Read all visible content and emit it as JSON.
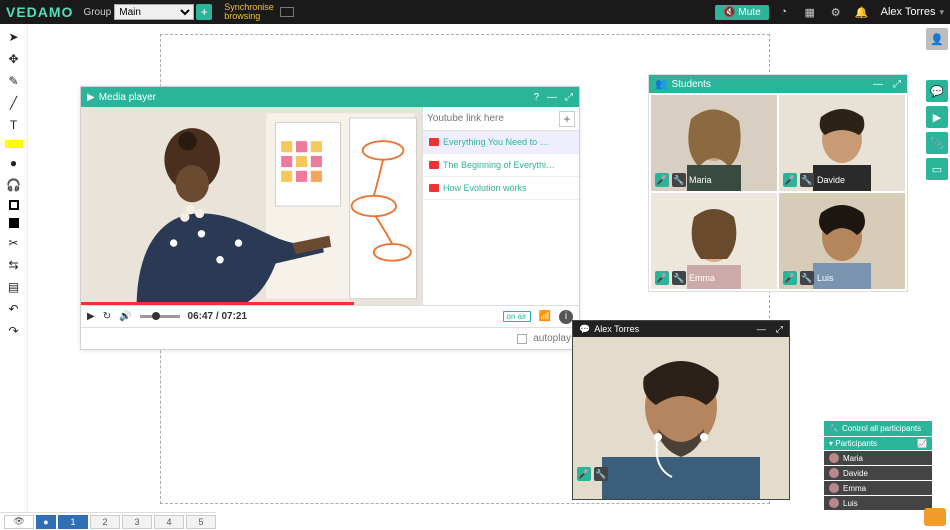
{
  "brand": "VEDAMO",
  "group": {
    "label": "Group",
    "value": "Main"
  },
  "sync_label": "Synchronise\nbrowsing",
  "mute_label": "Mute",
  "user_name": "Alex Torres",
  "media_player": {
    "title": "Media player",
    "search_placeholder": "Youtube link here",
    "playlist": [
      {
        "title": "Everything You Need to …",
        "selected": true
      },
      {
        "title": "The Beginning of Everythi…",
        "selected": false
      },
      {
        "title": "How Evolution works",
        "selected": false
      }
    ],
    "time_current": "06:47",
    "time_total": "07:21",
    "onair": "on air",
    "autoplay_label": "autoplay"
  },
  "students_panel": {
    "title": "Students",
    "cams": [
      {
        "name": "Maria"
      },
      {
        "name": "Davide"
      },
      {
        "name": "Emma"
      },
      {
        "name": "Luis"
      }
    ]
  },
  "teacher_panel": {
    "name": "Alex Torres"
  },
  "participants": {
    "control_label": "Control all participants",
    "title": "Participants",
    "list": [
      {
        "name": "Maria"
      },
      {
        "name": "Davide"
      },
      {
        "name": "Emma"
      },
      {
        "name": "Luis"
      }
    ]
  },
  "tabs": [
    "1",
    "2",
    "3",
    "4",
    "5"
  ],
  "active_tab": "1"
}
